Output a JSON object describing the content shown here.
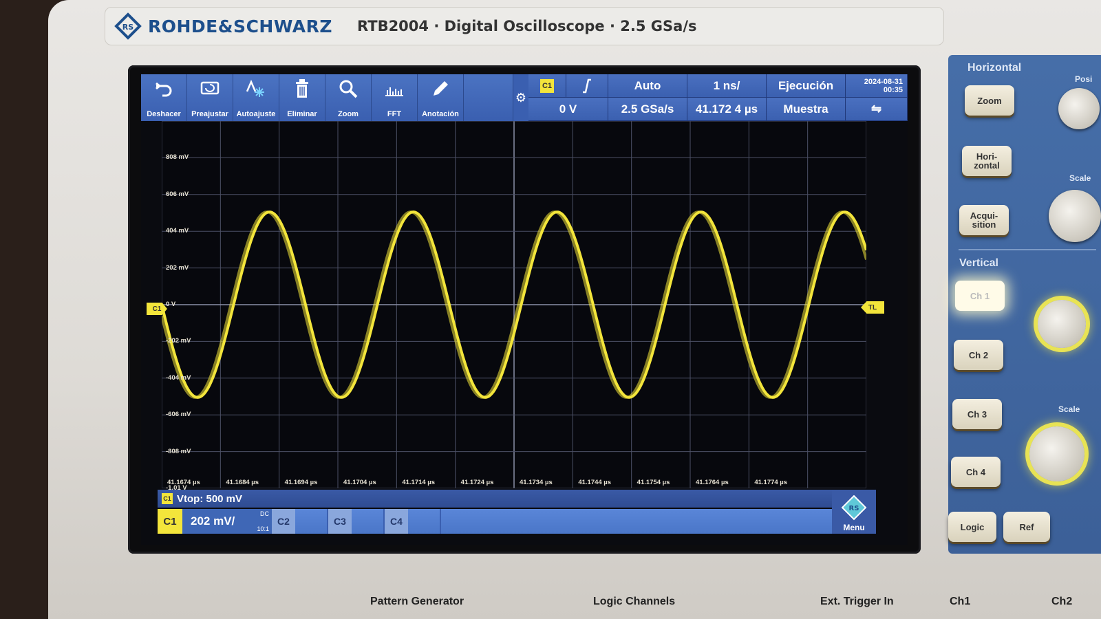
{
  "brand": {
    "name": "ROHDE&SCHWARZ",
    "model_line": "RTB2004 · Digital Oscilloscope · 2.5 GSa/s"
  },
  "toolbar": {
    "tools": [
      {
        "label": "Deshacer",
        "icon": "undo-icon"
      },
      {
        "label": "Preajustar",
        "icon": "preset-icon"
      },
      {
        "label": "Autoajuste",
        "icon": "autoset-icon"
      },
      {
        "label": "Eliminar",
        "icon": "trash-icon"
      },
      {
        "label": "Zoom",
        "icon": "zoom-icon"
      },
      {
        "label": "FFT",
        "icon": "fft-icon"
      },
      {
        "label": "Anotación",
        "icon": "pen-icon"
      }
    ]
  },
  "trigger_panel": {
    "source": "C1",
    "mode": "Auto",
    "time_scale": "1 ns/",
    "run_state": "Ejecución",
    "date": "2024-08-31",
    "time": "00:35",
    "level": "0 V",
    "sample_rate": "2.5 GSa/s",
    "position": "41.172 4 µs",
    "acq_mode": "Muestra"
  },
  "plot": {
    "y_labels": [
      "808 mV",
      "606 mV",
      "404 mV",
      "202 mV",
      "0 V",
      "-202 mV",
      "-404 mV",
      "-606 mV",
      "-808 mV",
      "-1.01 V"
    ],
    "x_labels": [
      "41.1674 µs",
      "41.1684 µs",
      "41.1694 µs",
      "41.1704 µs",
      "41.1714 µs",
      "41.1724 µs",
      "41.1734 µs",
      "41.1744 µs",
      "41.1754 µs",
      "41.1764 µs",
      "41.1774 µs"
    ],
    "channel_marker": "C1",
    "trigger_marker": "TL",
    "trace_color": "#f3e53b"
  },
  "chart_data": {
    "type": "line",
    "title": "",
    "xlabel": "",
    "ylabel": "",
    "x_unit": "µs",
    "ylim": [
      -1.01,
      1.01
    ],
    "series": [
      {
        "x": [
          41.1674,
          41.1684,
          41.1694,
          41.1704,
          41.1714,
          41.1724,
          41.1734,
          41.1744,
          41.1754,
          41.1764,
          41.1774
        ],
        "note_periods": 4.9
      }
    ]
  },
  "status": {
    "vtop_channel": "C1",
    "vtop": "Vtop: 500 mV"
  },
  "channels": {
    "c1_label": "C1",
    "c1_scale": "202 mV/",
    "c1_coupling": "DC",
    "c1_ratio": "10:1",
    "c2_label": "C2",
    "c3_label": "C3",
    "c4_label": "C4",
    "menu_label": "Menu"
  },
  "side_panel": {
    "horizontal_title": "Horizontal",
    "zoom": "Zoom",
    "horizontal": "Hori-\nzontal",
    "acquisition": "Acqui-\nsition",
    "position_label": "Posi",
    "scale_label_h": "Scale",
    "vertical_title": "Vertical",
    "ch1": "Ch 1",
    "ch2": "Ch 2",
    "ch3": "Ch 3",
    "ch4": "Ch 4",
    "scale_label_v": "Scale",
    "logic": "Logic",
    "ref": "Ref"
  },
  "bottom_labels": {
    "pattern_gen": "Pattern Generator",
    "logic_channels": "Logic Channels",
    "ext_trigger": "Ext. Trigger In",
    "ch1": "Ch1",
    "ch2": "Ch2"
  }
}
